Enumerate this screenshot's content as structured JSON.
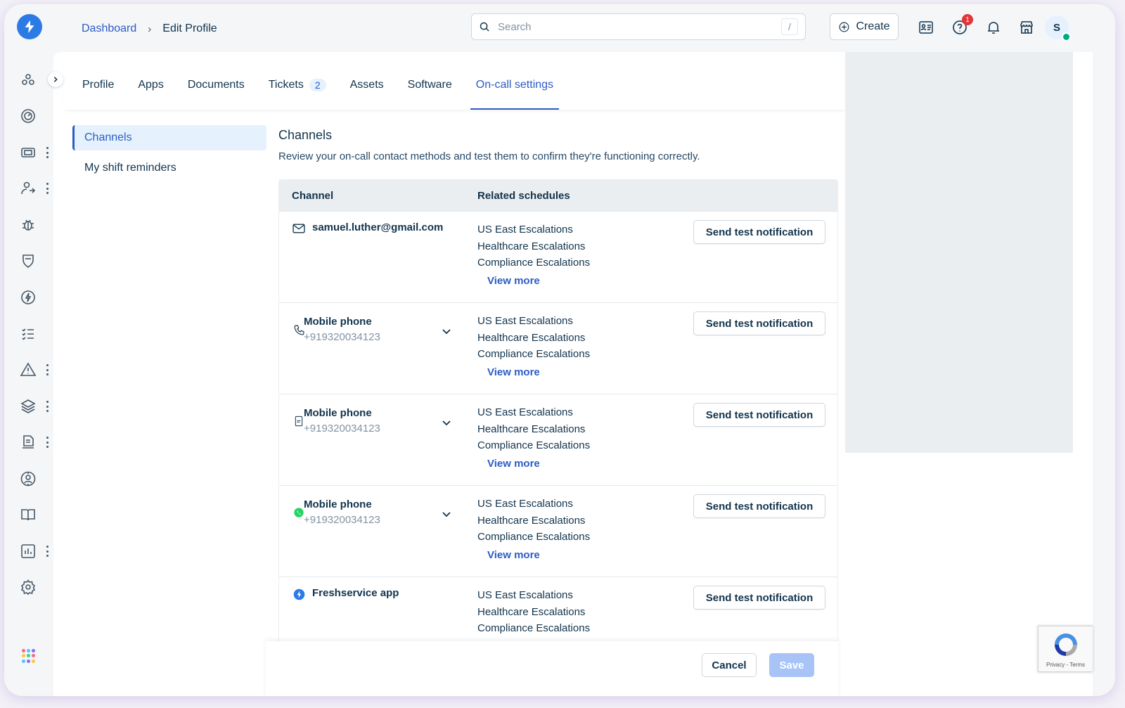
{
  "header": {
    "breadcrumb": {
      "root": "Dashboard",
      "current": "Edit Profile"
    },
    "search": {
      "placeholder": "Search",
      "shortcut": "/"
    },
    "create_label": "Create",
    "help_badge": "1",
    "avatar_initial": "S"
  },
  "tabs": [
    {
      "label": "Profile"
    },
    {
      "label": "Apps"
    },
    {
      "label": "Documents"
    },
    {
      "label": "Tickets",
      "count": "2"
    },
    {
      "label": "Assets"
    },
    {
      "label": "Software"
    },
    {
      "label": "On-call settings",
      "active": true
    }
  ],
  "subnav": {
    "items": [
      "Channels",
      "My shift reminders"
    ],
    "active": "Channels"
  },
  "section": {
    "title": "Channels",
    "description": "Review your on-call contact methods and test them to confirm they're functioning correctly."
  },
  "table": {
    "headers": {
      "channel": "Channel",
      "related": "Related schedules"
    },
    "test_label": "Send test notification",
    "view_more_label": "View more",
    "rows": [
      {
        "icon": "mail-icon",
        "name": "samuel.luther@gmail.com",
        "sub": "",
        "schedules": [
          "US East Escalations",
          "Healthcare Escalations",
          "Compliance Escalations"
        ],
        "view_more": true
      },
      {
        "icon": "phone-icon",
        "name": "Mobile phone",
        "sub": "+919320034123",
        "schedules": [
          "US East Escalations",
          "Healthcare Escalations",
          "Compliance Escalations"
        ],
        "view_more": true
      },
      {
        "icon": "sms-icon",
        "name": "Mobile phone",
        "sub": "+919320034123",
        "schedules": [
          "US East Escalations",
          "Healthcare Escalations",
          "Compliance Escalations"
        ],
        "view_more": true
      },
      {
        "icon": "whatsapp-icon",
        "name": "Mobile phone",
        "sub": "+919320034123",
        "schedules": [
          "US East Escalations",
          "Healthcare Escalations",
          "Compliance Escalations"
        ],
        "view_more": true
      },
      {
        "icon": "freshservice-icon",
        "name": "Freshservice app",
        "sub": "",
        "schedules": [
          "US East Escalations",
          "Healthcare Escalations",
          "Compliance Escalations"
        ],
        "view_more": false
      }
    ]
  },
  "footer": {
    "cancel_label": "Cancel",
    "save_label": "Save"
  },
  "recaptcha": {
    "text": "Privacy - Terms"
  },
  "colors": {
    "accent": "#2c5cc5",
    "brand": "#2c7be5",
    "online": "#00a886",
    "badge": "#e43538"
  }
}
